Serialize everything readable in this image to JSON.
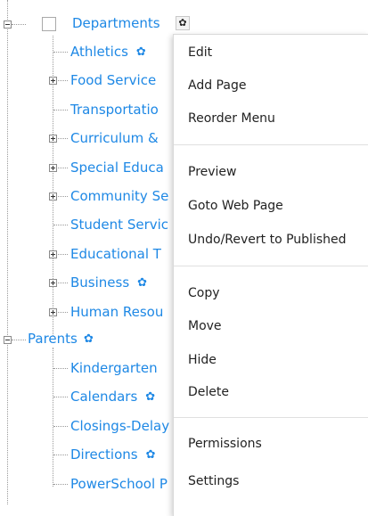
{
  "tree": {
    "departments": {
      "label": "Departments",
      "gear_icon": "gear-icon",
      "children": [
        {
          "label": "Athletics",
          "expandable": false,
          "gear": true
        },
        {
          "label": "Food Service",
          "expandable": true,
          "gear": false
        },
        {
          "label": "Transportatio",
          "expandable": false,
          "gear": false
        },
        {
          "label": "Curriculum &",
          "expandable": true,
          "gear": false
        },
        {
          "label": "Special Educa",
          "expandable": true,
          "gear": false
        },
        {
          "label": "Community Se",
          "expandable": true,
          "gear": false
        },
        {
          "label": "Student Servic",
          "expandable": false,
          "gear": false
        },
        {
          "label": "Educational T",
          "expandable": true,
          "gear": false
        },
        {
          "label": "Business",
          "expandable": true,
          "gear": true
        },
        {
          "label": "Human Resou",
          "expandable": true,
          "gear": false
        }
      ]
    },
    "parents": {
      "label": "Parents",
      "children": [
        {
          "label": "Kindergarten",
          "gear": false
        },
        {
          "label": "Calendars",
          "gear": true
        },
        {
          "label": "Closings-Delay",
          "gear": false
        },
        {
          "label": "Directions",
          "gear": true
        },
        {
          "label": "PowerSchool P",
          "gear": false
        }
      ]
    }
  },
  "context_menu": {
    "groups": [
      [
        "Edit",
        "Add Page",
        "Reorder Menu"
      ],
      [
        "Preview",
        "Goto Web Page",
        "Undo/Revert to Published"
      ],
      [
        "Copy",
        "Move",
        "Hide",
        "Delete"
      ],
      [
        "Permissions",
        "Settings"
      ]
    ]
  },
  "colors": {
    "link": "#1e88e5",
    "menu_text": "#222222",
    "separator": "#e0e0e0"
  }
}
